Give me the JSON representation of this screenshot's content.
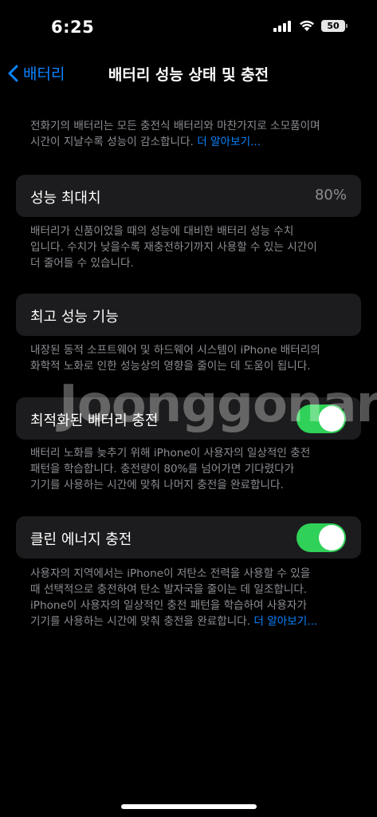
{
  "status_bar": {
    "time": "6:25",
    "battery_level": "50"
  },
  "nav": {
    "back_label": "배터리",
    "title": "배터리 성능 상태 및 충전"
  },
  "intro": {
    "line1": "전화기의 배터리는 모든 충전식 배터리와 마찬가지로 소모품이며",
    "line2": "시간이 지날수록 성능이 감소합니다.",
    "learn_more": "더 알아보기..."
  },
  "max_capacity": {
    "label": "성능 최대치",
    "value": "80%",
    "desc_line1": "배터리가 신품이었을 때의 성능에 대비한 배터리 성능 수치",
    "desc_line2": "입니다. 수치가 낮을수록 재충전하기까지 사용할 수 있는 시간이",
    "desc_line3": "더 줄어들 수 있습니다."
  },
  "peak_performance": {
    "label": "최고 성능 기능",
    "desc_line1": "내장된 동적 소프트웨어 및 하드웨어 시스템이 iPhone 배터리의",
    "desc_line2": "화학적 노화로 인한 성능상의 영향을 줄이는 데 도움이 됩니다."
  },
  "optimized_charging": {
    "label": "최적화된 배터리 충전",
    "enabled": true,
    "desc_line1": "배터리 노화를 늦추기 위해 iPhone이 사용자의 일상적인 충전",
    "desc_line2": "패턴을 학습합니다. 충전량이 80%를 넘어가면 기다렸다가",
    "desc_line3": "기기를 사용하는 시간에 맞춰 나머지 충전을 완료합니다."
  },
  "clean_energy": {
    "label": "클린 에너지 충전",
    "enabled": true,
    "desc_line1": "사용자의 지역에서는 iPhone이 저탄소 전력을 사용할 수 있을",
    "desc_line2": "때 선택적으로 충전하여 탄소 발자국을 줄이는 데 일조합니다.",
    "desc_line3": "iPhone이 사용자의 일상적인 충전 패턴을 학습하여 사용자가",
    "desc_line4": "기기를 사용하는 시간에 맞춰 충전을 완료합니다.",
    "learn_more": "더 알아보기..."
  },
  "watermark": "Joonggonara",
  "colors": {
    "accent": "#0a84ff",
    "toggle_on": "#30d158",
    "cell_bg": "#1c1c1e",
    "secondary_text": "#8d8d93"
  }
}
